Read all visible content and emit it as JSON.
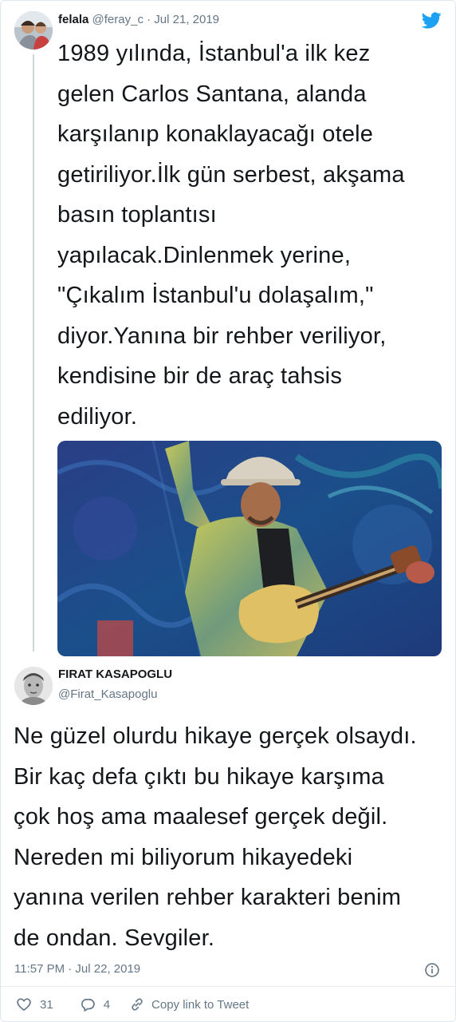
{
  "tweet": {
    "author_name": "felala",
    "author_handle": "@feray_c",
    "date_separator": "·",
    "date": "Jul 21, 2019",
    "text": "1989 yılında, İstanbul'a ilk kez\ngelen Carlos Santana, alanda\nkarşılanıp konaklayacağı otele\ngetiriliyor.İlk gün serbest, akşama\nbasın toplantısı\nyapılacak.Dinlenmek yerine,\n\"Çıkalım İstanbul'u dolaşalım,\"\ndiyor.Yanına bir rehber veriliyor,\nkendisine bir de araç tahsis\nediliyor."
  },
  "reply": {
    "author_name": "FIRAT KASAPOGLU",
    "author_handle": "@Firat_Kasapoglu",
    "text": "Ne güzel olurdu hikaye gerçek olsaydı.\nBir kaç defa çıktı bu hikaye karşıma\nçok hoş ama maalesef gerçek değil.\nNereden mi biliyorum hikayedeki\nyanına verilen rehber karakteri benim\nde ondan. Sevgiler.",
    "timestamp": "11:57 PM · Jul 22, 2019"
  },
  "actions": {
    "likes": "31",
    "replies": "4",
    "copy_link_label": "Copy link to Tweet"
  },
  "colors": {
    "twitter_blue": "#1da1f2",
    "muted_text": "#657786",
    "body_text": "#14171a"
  },
  "icons": [
    "twitter-bird-icon",
    "info-icon",
    "heart-icon",
    "reply-icon",
    "link-icon"
  ]
}
